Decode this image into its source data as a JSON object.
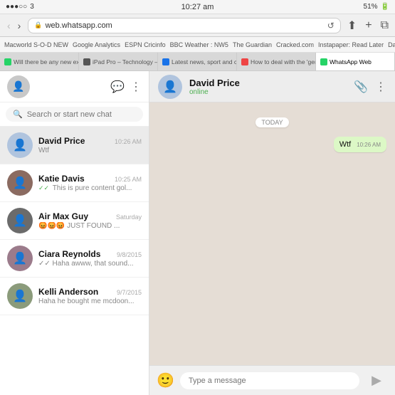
{
  "statusBar": {
    "signal": "●●●○○",
    "carrier": "3",
    "time": "10:27 am",
    "battery": "51%",
    "wifi": "▲"
  },
  "browser": {
    "addressUrl": "web.whatsapp.com",
    "reloadIcon": "↺",
    "shareIcon": "⬆",
    "plusIcon": "+",
    "tabsIcon": "⧉"
  },
  "bookmarks": [
    "Macworld S-O-D NEW",
    "Google Analytics",
    "ESPN Cricinfo",
    "BBC Weather : NW5",
    "The Guardian",
    "Cracked.com",
    "Instapaper: Read Later",
    "Dailymotion"
  ],
  "tabs": [
    {
      "label": "Will there be any new expans...",
      "active": false
    },
    {
      "label": "iPad Pro – Technology – Apple",
      "active": false
    },
    {
      "label": "Latest news, sport and comm...",
      "active": false
    },
    {
      "label": "How to deal with the 'gentle...",
      "active": false
    },
    {
      "label": "WhatsApp Web",
      "active": true
    }
  ],
  "sidebar": {
    "searchPlaceholder": "Search or start new chat",
    "chats": [
      {
        "name": "David Price",
        "time": "10:26 AM",
        "preview": "Wtf",
        "tick": false,
        "active": true,
        "avatarColor": "b0c4de"
      },
      {
        "name": "Katie Davis",
        "time": "10:25 AM",
        "preview": "This is pure content gol...",
        "tick": true,
        "active": false,
        "avatarColor": "8B6B61"
      },
      {
        "name": "Air Max Guy",
        "time": "Saturday",
        "preview": "😡😡😡 JUST FOUND ...",
        "tick": false,
        "active": false,
        "avatarColor": "6B6B6B"
      },
      {
        "name": "Ciara Reynolds",
        "time": "9/8/2015",
        "preview": "✓✓ Haha awww, that sound...",
        "tick": true,
        "active": false,
        "avatarColor": "9B7B8B"
      },
      {
        "name": "Kelli Anderson",
        "time": "9/7/2015",
        "preview": "Haha he bought me mcdoon...",
        "tick": false,
        "active": false,
        "avatarColor": "8B9B7B"
      }
    ]
  },
  "chat": {
    "name": "David Price",
    "status": "online",
    "dateSeparator": "TODAY",
    "messages": [
      {
        "text": "Wtf",
        "time": "10:26 AM",
        "sent": true
      }
    ],
    "inputPlaceholder": "Type a message"
  }
}
